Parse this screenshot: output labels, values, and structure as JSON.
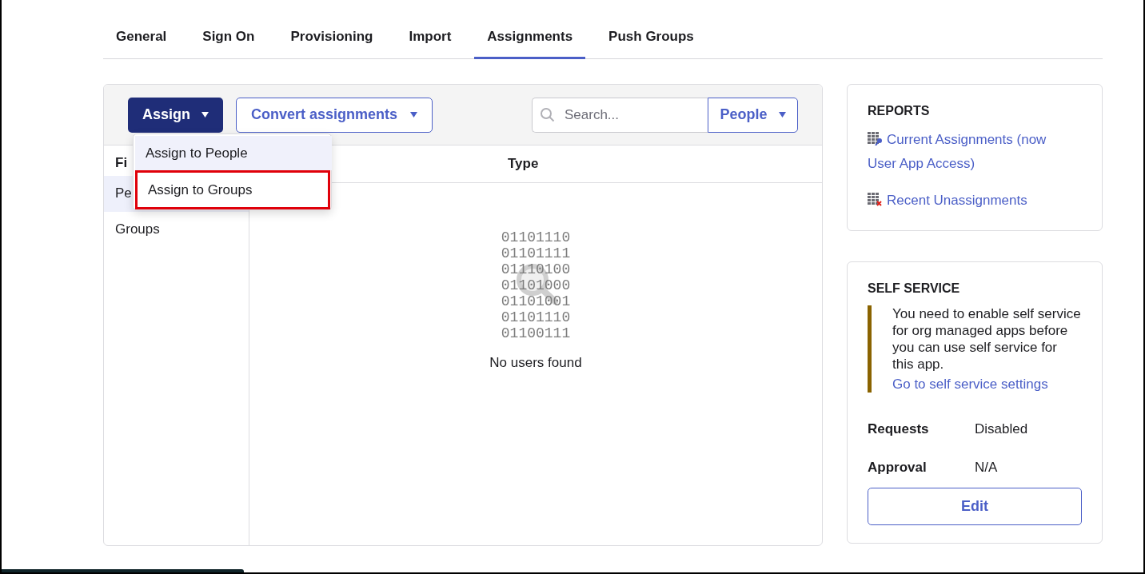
{
  "tabs": [
    {
      "label": "General",
      "selected": false
    },
    {
      "label": "Sign On",
      "selected": false
    },
    {
      "label": "Provisioning",
      "selected": false
    },
    {
      "label": "Import",
      "selected": false
    },
    {
      "label": "Assignments",
      "selected": true
    },
    {
      "label": "Push Groups",
      "selected": false
    }
  ],
  "toolbar": {
    "assign_button": "Assign",
    "convert_button": "Convert assignments",
    "search": {
      "placeholder": "Search..."
    },
    "filter_button": "People"
  },
  "assign_menu": [
    {
      "label": "Assign to People",
      "hovered": true,
      "highlighted": false
    },
    {
      "label": "Assign to Groups",
      "hovered": false,
      "highlighted": true
    }
  ],
  "sidebar": {
    "heading": "Fi",
    "items": [
      {
        "label": "Pe",
        "selected": true
      },
      {
        "label": "Groups",
        "selected": false
      }
    ]
  },
  "table": {
    "columns": [
      "Type"
    ],
    "empty_state": {
      "binary_lines": [
        "01101110",
        "01101111",
        "01110100",
        "01101000",
        "01101001",
        "01101110",
        "01100111"
      ],
      "message": "No users found"
    }
  },
  "reports": {
    "title": "REPORTS",
    "links": [
      {
        "kind": "current",
        "label": "Current Assignments (now User App Access)"
      },
      {
        "kind": "recent",
        "label": "Recent Unassignments"
      }
    ]
  },
  "self_service": {
    "title": "SELF SERVICE",
    "notice": "You need to enable self service for org managed apps before you can use self service for this app.",
    "notice_link": "Go to self service settings",
    "fields": [
      {
        "label": "Requests",
        "value": "Disabled"
      },
      {
        "label": "Approval",
        "value": "N/A"
      }
    ],
    "edit_button": "Edit"
  }
}
